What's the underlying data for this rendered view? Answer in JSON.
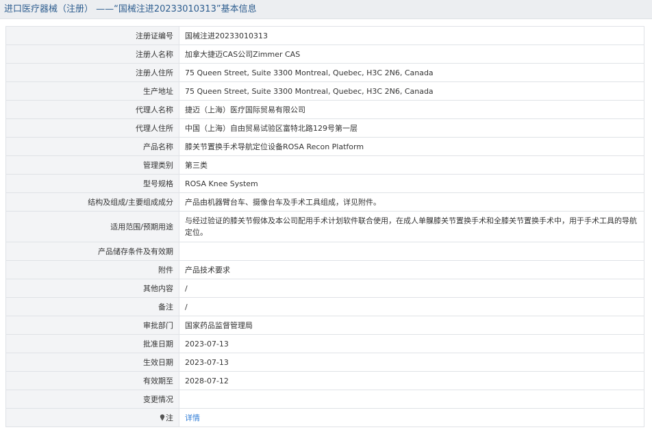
{
  "header": {
    "title": "进口医疗器械（注册） ——“国械注进20233010313”基本信息"
  },
  "rows": [
    {
      "label": "注册证编号",
      "value": "国械注进20233010313"
    },
    {
      "label": "注册人名称",
      "value": "加拿大捷迈CAS公司Zimmer CAS"
    },
    {
      "label": "注册人住所",
      "value": "75 Queen Street, Suite 3300 Montreal, Quebec, H3C 2N6, Canada"
    },
    {
      "label": "生产地址",
      "value": "75 Queen Street, Suite 3300 Montreal, Quebec, H3C 2N6, Canada"
    },
    {
      "label": "代理人名称",
      "value": "捷迈（上海）医疗国际贸易有限公司"
    },
    {
      "label": "代理人住所",
      "value": "中国（上海）自由贸易试验区富特北路129号第一层"
    },
    {
      "label": "产品名称",
      "value": "膝关节置换手术导航定位设备ROSA Recon Platform"
    },
    {
      "label": "管理类别",
      "value": "第三类"
    },
    {
      "label": "型号规格",
      "value": "ROSA Knee System"
    },
    {
      "label": "结构及组成/主要组成成分",
      "value": "产品由机器臂台车、摄像台车及手术工具组成，详见附件。"
    },
    {
      "label": "适用范围/预期用途",
      "value": "与经过验证的膝关节假体及本公司配用手术计划软件联合使用，在成人单髁膝关节置换手术和全膝关节置换手术中，用于手术工具的导航定位。"
    },
    {
      "label": "产品储存条件及有效期",
      "value": ""
    },
    {
      "label": "附件",
      "value": "产品技术要求"
    },
    {
      "label": "其他内容",
      "value": "/"
    },
    {
      "label": "备注",
      "value": "/"
    },
    {
      "label": "审批部门",
      "value": "国家药品监督管理局"
    },
    {
      "label": "批准日期",
      "value": "2023-07-13"
    },
    {
      "label": "生效日期",
      "value": "2023-07-13"
    },
    {
      "label": "有效期至",
      "value": "2028-07-12"
    },
    {
      "label": "变更情况",
      "value": ""
    },
    {
      "label": "注",
      "value": "详情",
      "icon": "pin-icon"
    }
  ]
}
